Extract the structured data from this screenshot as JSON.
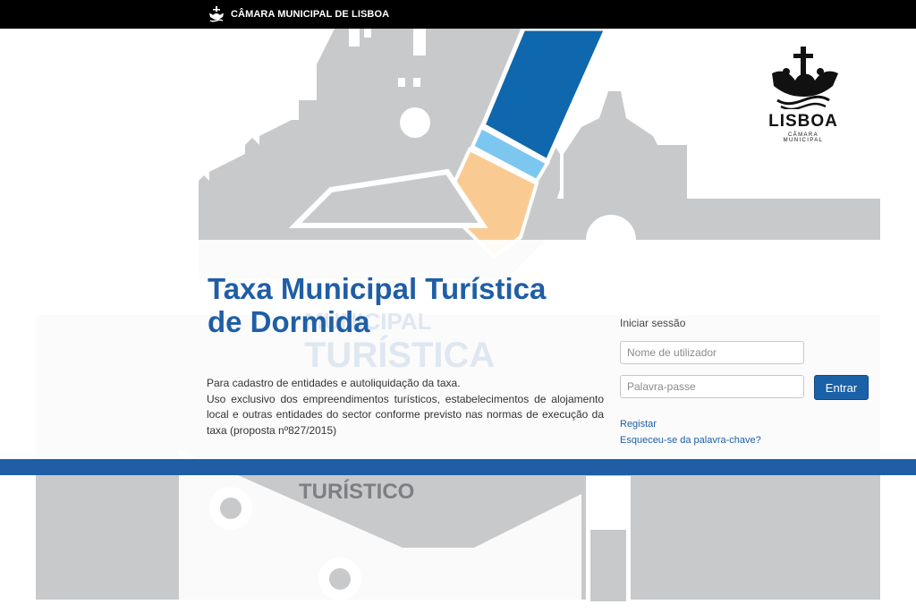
{
  "header": {
    "brand": "CÂMARA MUNICIPAL DE LISBOA"
  },
  "logo": {
    "word": "LISBOA",
    "sub": "CÂMARA MUNICIPAL"
  },
  "background": {
    "text_lines": [
      "MUNICIPAL",
      "TURÍSTICA",
      "TURÍSTICO"
    ]
  },
  "main": {
    "title_line1": "Taxa Municipal Turística",
    "title_line2": "de Dormida",
    "desc_line1": "Para cadastro de entidades e autoliquidação da taxa.",
    "desc_line2": "Uso exclusivo dos empreendimentos turísticos, estabelecimentos de alojamento local e outras entidades do sector conforme previsto nas normas de execução da taxa (proposta nº827/2015)"
  },
  "login": {
    "heading": "Iniciar sessão",
    "username_placeholder": "Nome de utilizador",
    "password_placeholder": "Palavra-passe",
    "submit_label": "Entrar",
    "register_link": "Registar",
    "forgot_link": "Esqueceu-se da palavra-chave?"
  },
  "colors": {
    "brand_blue": "#1f5ea6",
    "illustration_gray": "#c8c9cb",
    "arm_blue": "#0f67ad",
    "hand": "#f9cb93"
  }
}
